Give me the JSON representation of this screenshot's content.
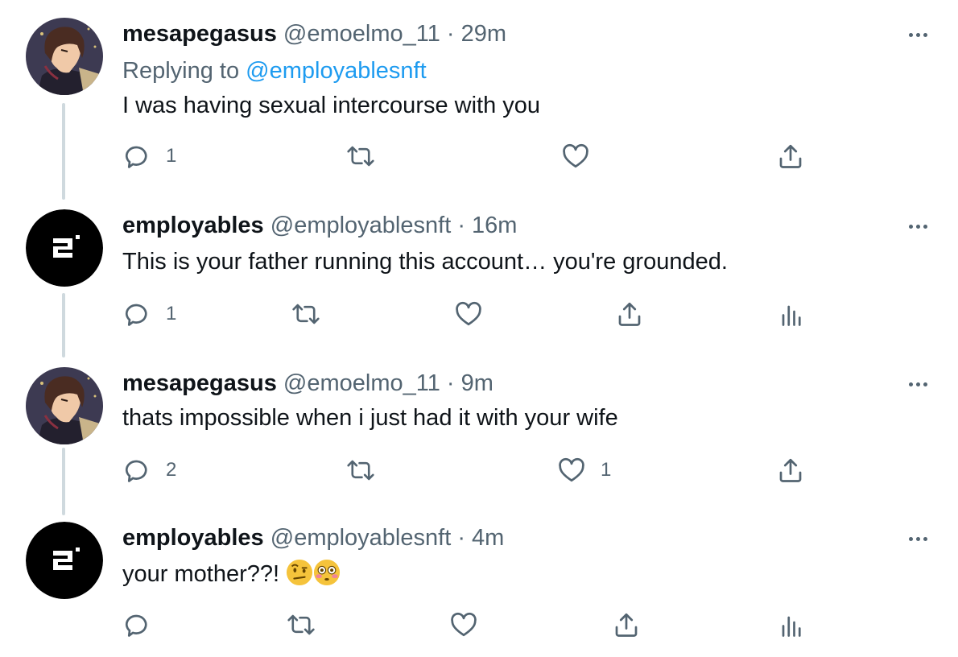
{
  "tweets": [
    {
      "name": "mesapegasus",
      "handle": "@emoelmo_11",
      "sep": "·",
      "time": "29m",
      "avatar": "anime-avatar",
      "replying_prefix": "Replying to",
      "replying_handle": "@employablesnft",
      "text": "I was having sexual intercourse with you",
      "reply_count": "1",
      "retweet_count": "",
      "like_count": "",
      "has_analytics": false
    },
    {
      "name": "employables",
      "handle": "@employablesnft",
      "sep": "·",
      "time": "16m",
      "avatar": "employables-logo",
      "text": "This is your father running this account… you're grounded.",
      "reply_count": "1",
      "retweet_count": "",
      "like_count": "",
      "has_analytics": true
    },
    {
      "name": "mesapegasus",
      "handle": "@emoelmo_11",
      "sep": "·",
      "time": "9m",
      "avatar": "anime-avatar",
      "text": "thats impossible when i just had it with your wife",
      "reply_count": "2",
      "retweet_count": "",
      "like_count": "1",
      "has_analytics": false
    },
    {
      "name": "employables",
      "handle": "@employablesnft",
      "sep": "·",
      "time": "4m",
      "avatar": "employables-logo",
      "text": "your mother??!",
      "emojis": [
        "face-with-raised-eyebrow",
        "flushed-face"
      ],
      "reply_count": "",
      "retweet_count": "",
      "like_count": "",
      "has_analytics": true
    }
  ],
  "colors": {
    "text": "#0f1419",
    "secondary": "#536471",
    "link": "#1d9bf0",
    "thread_line": "#cfd9de"
  },
  "icons": [
    "reply-icon",
    "retweet-icon",
    "like-icon",
    "share-icon",
    "analytics-icon",
    "more-icon"
  ]
}
